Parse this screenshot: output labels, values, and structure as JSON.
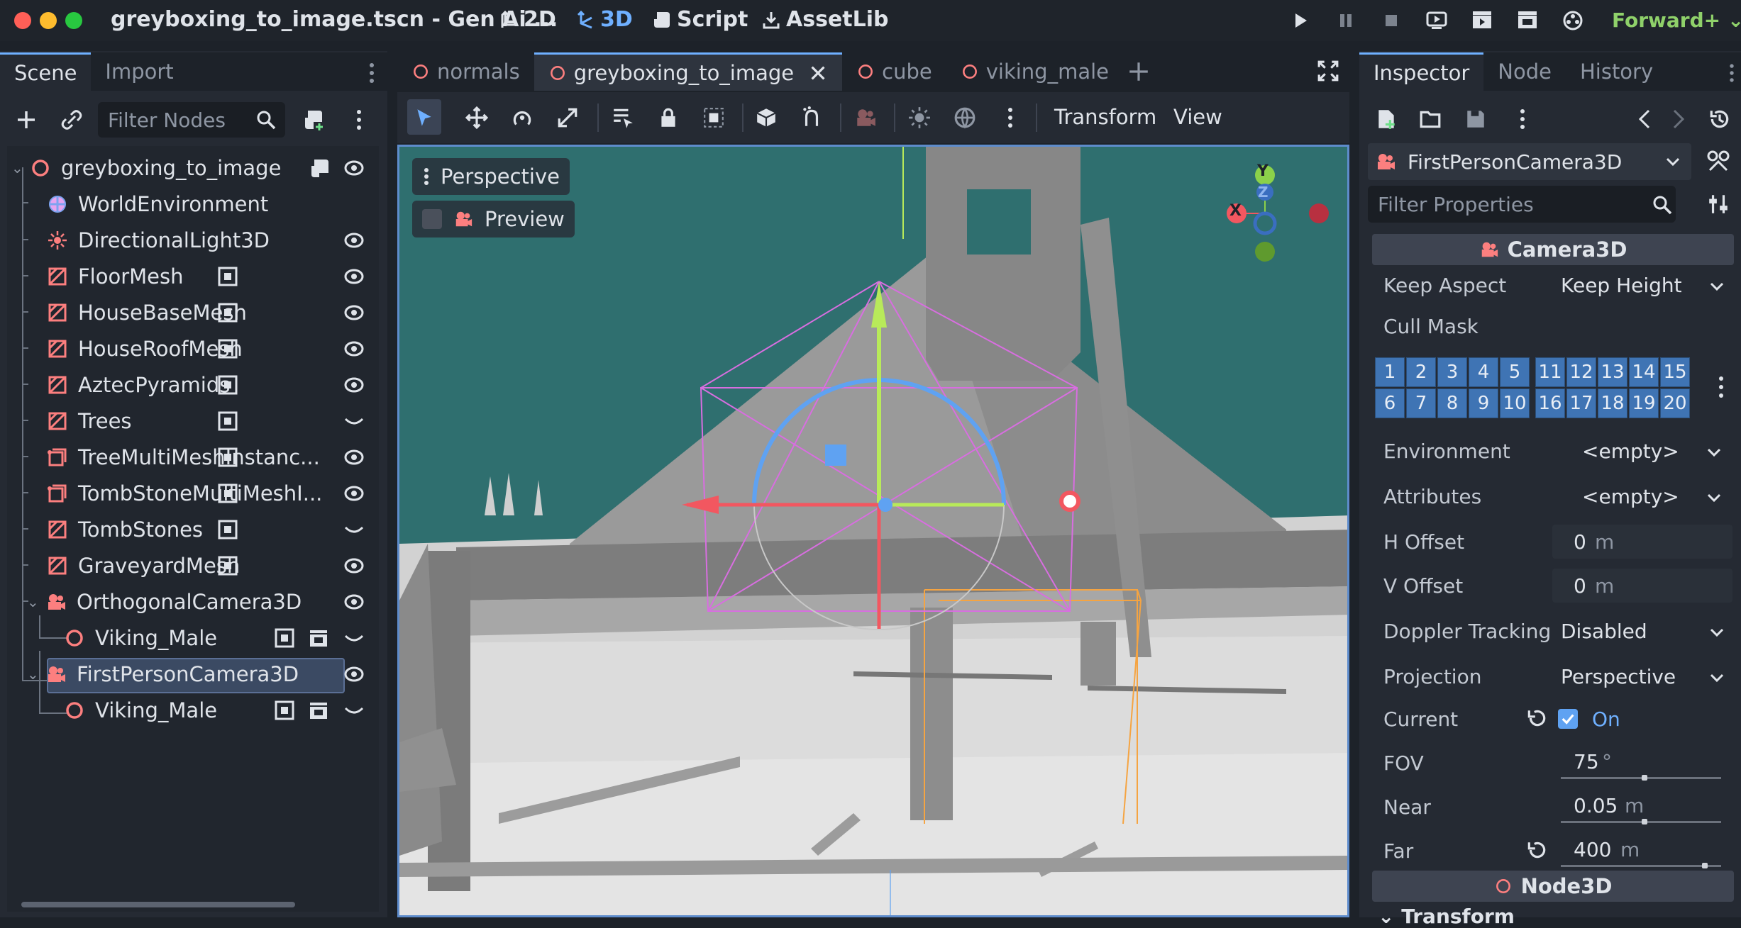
{
  "window": {
    "title": "greyboxing_to_image.tscn - Gen Ai ...",
    "traffic_colors": [
      "#ff5f57",
      "#febc2e",
      "#28c840"
    ]
  },
  "workspaces": {
    "two_d": "2D",
    "three_d": "3D",
    "script": "Script",
    "assetlib": "AssetLib"
  },
  "renderer": "Forward+",
  "scene_dock": {
    "tabs": [
      "Scene",
      "Import"
    ],
    "filter_placeholder": "Filter Nodes",
    "nodes": [
      {
        "label": "greyboxing_to_image",
        "icon": "node3d-icon"
      },
      {
        "label": "WorldEnvironment",
        "icon": "world-environment-icon"
      },
      {
        "label": "DirectionalLight3D",
        "icon": "directional-light-icon"
      },
      {
        "label": "FloorMesh",
        "icon": "mesh-instance-icon"
      },
      {
        "label": "HouseBaseMesh",
        "icon": "mesh-instance-icon"
      },
      {
        "label": "HouseRoofMesh",
        "icon": "mesh-instance-icon"
      },
      {
        "label": "AztecPyramids",
        "icon": "mesh-instance-icon"
      },
      {
        "label": "Trees",
        "icon": "mesh-instance-icon"
      },
      {
        "label": "TreeMultiMeshInstanc...",
        "icon": "multimesh-icon"
      },
      {
        "label": "TombStoneMultiMeshI...",
        "icon": "multimesh-icon"
      },
      {
        "label": "TombStones",
        "icon": "mesh-instance-icon"
      },
      {
        "label": "GraveyardMesh",
        "icon": "mesh-instance-icon"
      },
      {
        "label": "OrthogonalCamera3D",
        "icon": "camera-icon"
      },
      {
        "label": "Viking_Male",
        "icon": "node3d-icon"
      },
      {
        "label": "FirstPersonCamera3D",
        "icon": "camera-icon"
      },
      {
        "label": "Viking_Male",
        "icon": "node3d-icon"
      }
    ]
  },
  "editor_tabs": [
    "normals",
    "greyboxing_to_image",
    "cube",
    "viking_male"
  ],
  "toolbar": {
    "transform": "Transform",
    "view": "View"
  },
  "viewport": {
    "perspective": "Perspective",
    "preview": "Preview",
    "gizmo_x": "X",
    "gizmo_y": "Y",
    "gizmo_z": "Z"
  },
  "inspector": {
    "tabs": [
      "Inspector",
      "Node",
      "History"
    ],
    "selected_node": "FirstPersonCamera3D",
    "filter_placeholder": "Filter Properties",
    "section": "Camera3D",
    "cull_mask_row1": [
      "1",
      "2",
      "3",
      "4",
      "5",
      "11",
      "12",
      "13",
      "14",
      "15"
    ],
    "cull_mask_row2": [
      "6",
      "7",
      "8",
      "9",
      "10",
      "16",
      "17",
      "18",
      "19",
      "20"
    ],
    "props": {
      "keep_aspect": {
        "label": "Keep Aspect",
        "value": "Keep Height"
      },
      "cull_mask": {
        "label": "Cull Mask"
      },
      "environment": {
        "label": "Environment",
        "value": "<empty>"
      },
      "attributes": {
        "label": "Attributes",
        "value": "<empty>"
      },
      "h_offset": {
        "label": "H Offset",
        "value": "0",
        "unit": "m"
      },
      "v_offset": {
        "label": "V Offset",
        "value": "0",
        "unit": "m"
      },
      "doppler": {
        "label": "Doppler Tracking",
        "value": "Disabled"
      },
      "projection": {
        "label": "Projection",
        "value": "Perspective"
      },
      "current": {
        "label": "Current",
        "value": "On"
      },
      "fov": {
        "label": "FOV",
        "value": "75",
        "unit": "°",
        "level": 0.52
      },
      "near": {
        "label": "Near",
        "value": "0.05",
        "unit": "m",
        "level": 0.52
      },
      "far": {
        "label": "Far",
        "value": "400",
        "unit": "m",
        "level": 0.9
      }
    },
    "section2": "Node3D",
    "section3": "Transform"
  }
}
